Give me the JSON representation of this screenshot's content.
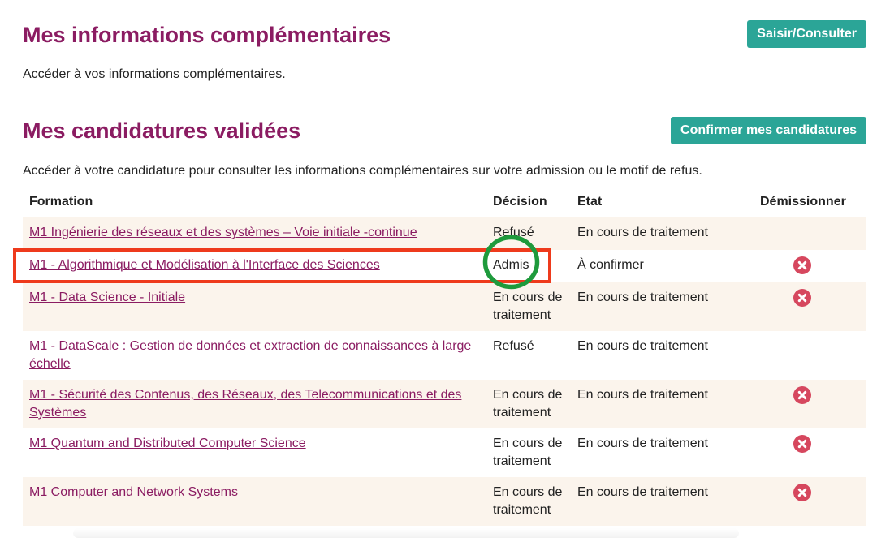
{
  "colors": {
    "heading": "#8b1c62",
    "link": "#8b1c62",
    "button_bg": "#2ba597",
    "button_text": "#ffffff",
    "row_stripe": "#fbf4ec",
    "resign_icon": "#d6475e",
    "text": "#222222",
    "annotation_box": "#ee3a1c",
    "annotation_circle": "#1e9a3c"
  },
  "info_section": {
    "title": "Mes informations complémentaires",
    "button_label": "Saisir/Consulter",
    "description": "Accéder à vos informations complémentaires."
  },
  "candidatures_section": {
    "title": "Mes candidatures validées",
    "button_label": "Confirmer mes candidatures",
    "description": "Accéder à votre candidature pour consulter les informations complémentaires sur votre admission ou le motif de refus."
  },
  "table": {
    "headers": {
      "formation": "Formation",
      "decision": "Décision",
      "etat": "Etat",
      "demissionner": "Démissionner"
    },
    "resign_icon": "close-circle-icon",
    "rows": [
      {
        "formation": "M1 Ingénierie des réseaux et des systèmes – Voie initiale -continue",
        "decision": "Refusé",
        "etat": "En cours de traitement",
        "resign_available": false
      },
      {
        "formation": "M1 - Algorithmique et Modélisation à l'Interface des Sciences",
        "decision": "Admis",
        "etat": "À confirmer",
        "resign_available": true
      },
      {
        "formation": "M1 - Data Science - Initiale",
        "decision": "En cours de traitement",
        "etat": "En cours de traitement",
        "resign_available": true
      },
      {
        "formation": "M1 - DataScale : Gestion de données et extraction de connaissances à large échelle",
        "decision": "Refusé",
        "etat": "En cours de traitement",
        "resign_available": false
      },
      {
        "formation": "M1 - Sécurité des Contenus, des Réseaux, des Telecommunications et des Systèmes",
        "decision": "En cours de traitement",
        "etat": "En cours de traitement",
        "resign_available": true
      },
      {
        "formation": "M1 Quantum and Distributed Computer Science",
        "decision": "En cours de traitement",
        "etat": "En cours de traitement",
        "resign_available": true
      },
      {
        "formation": "M1 Computer and Network Systems",
        "decision": "En cours de traitement",
        "etat": "En cours de traitement",
        "resign_available": true
      }
    ]
  }
}
